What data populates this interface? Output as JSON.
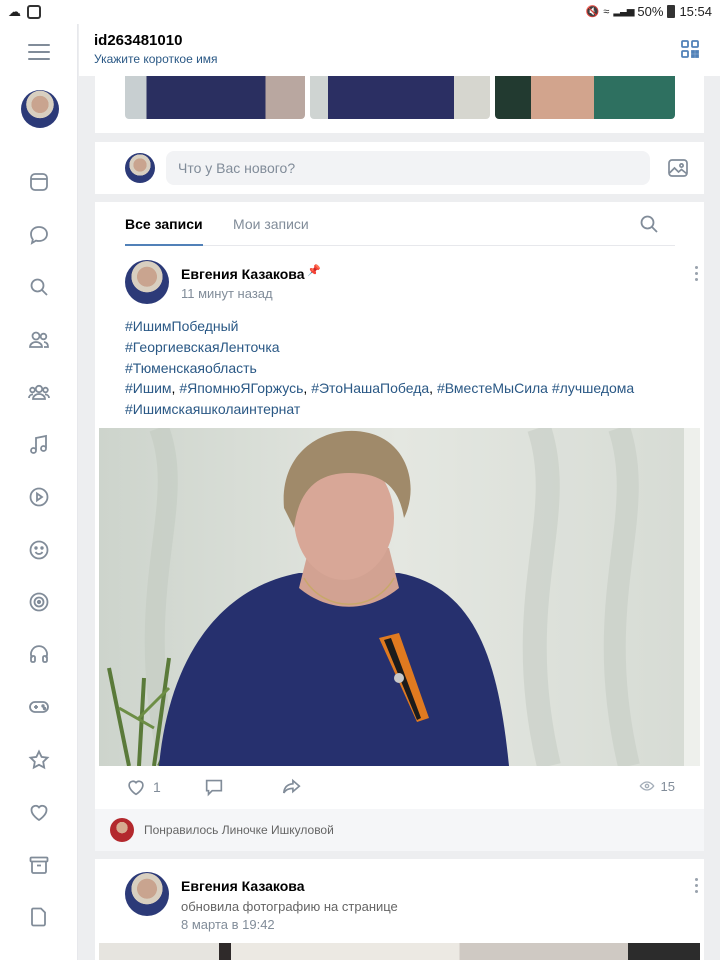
{
  "status_bar": {
    "battery": "50%",
    "time": "15:54"
  },
  "header": {
    "user_id": "id263481010",
    "short_name_hint": "Укажите короткое имя"
  },
  "sidebar": {
    "items": [
      {
        "icon": "news-icon"
      },
      {
        "icon": "messages-icon"
      },
      {
        "icon": "search-icon"
      },
      {
        "icon": "friends-icon"
      },
      {
        "icon": "groups-icon"
      },
      {
        "icon": "music-icon"
      },
      {
        "icon": "video-icon"
      },
      {
        "icon": "games-smile-icon"
      },
      {
        "icon": "target-icon"
      },
      {
        "icon": "podcasts-icon"
      },
      {
        "icon": "gamepad-icon"
      },
      {
        "icon": "bookmarks-star-icon"
      },
      {
        "icon": "likes-heart-icon"
      },
      {
        "icon": "archive-icon"
      },
      {
        "icon": "documents-icon"
      },
      {
        "icon": "payments-icon"
      }
    ]
  },
  "compose": {
    "placeholder": "Что у Вас нового?"
  },
  "tabs": {
    "all": "Все записи",
    "mine": "Мои записи"
  },
  "post": {
    "author": "Евгения Казакова",
    "time": "11 минут назад",
    "tags": {
      "t1": "#ИшимПобедный",
      "t2": "#ГеоргиевскаяЛенточка",
      "t3": "#Тюменскаяобласть",
      "t4": "#Ишим",
      "t5": "#ЯпомнюЯГоржусь",
      "t6": "#ЭтоНашаПобеда",
      "t7": "#ВместеМыСила",
      "t8": "#лучшедома",
      "t9": "#Ишимскаяшколаинтернат",
      "comma": ","
    },
    "likes": "1",
    "views": "15"
  },
  "liked_by": "Понравилось Линочке Ишкуловой",
  "post2": {
    "author": "Евгения Казакова",
    "action": "обновила фотографию на странице",
    "time": "8 марта в 19:42"
  },
  "colors": {
    "link": "#2a5885",
    "accent": "#5181b8",
    "secondary": "#818c99",
    "background": "#edeef0"
  }
}
